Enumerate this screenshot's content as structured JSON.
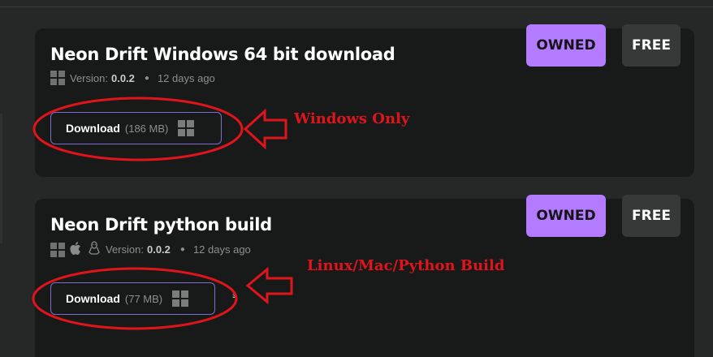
{
  "builds": [
    {
      "title": "Neon Drift Windows 64 bit download",
      "version_label": "Version:",
      "version": "0.0.2",
      "updated": "12 days ago",
      "platform_icons": [
        "windows-icon"
      ],
      "download_label": "Download",
      "size": "(186 MB)",
      "owned_label": "OWNED",
      "free_label": "FREE"
    },
    {
      "title": "Neon Drift python build",
      "version_label": "Version:",
      "version": "0.0.2",
      "updated": "12 days ago",
      "platform_icons": [
        "windows-icon",
        "apple-icon",
        "linux-icon"
      ],
      "download_label": "Download",
      "size": "(77 MB)",
      "owned_label": "OWNED",
      "free_label": "FREE"
    }
  ],
  "annotations": {
    "windows": "Windows Only",
    "linux_mac": "Linux/Mac/Python Build",
    "color": "#e0141b"
  },
  "colors": {
    "background": "#252827",
    "card": "#181a19",
    "owned": "#b37bff",
    "free": "#363938",
    "download_border": "#7d6dd0"
  }
}
